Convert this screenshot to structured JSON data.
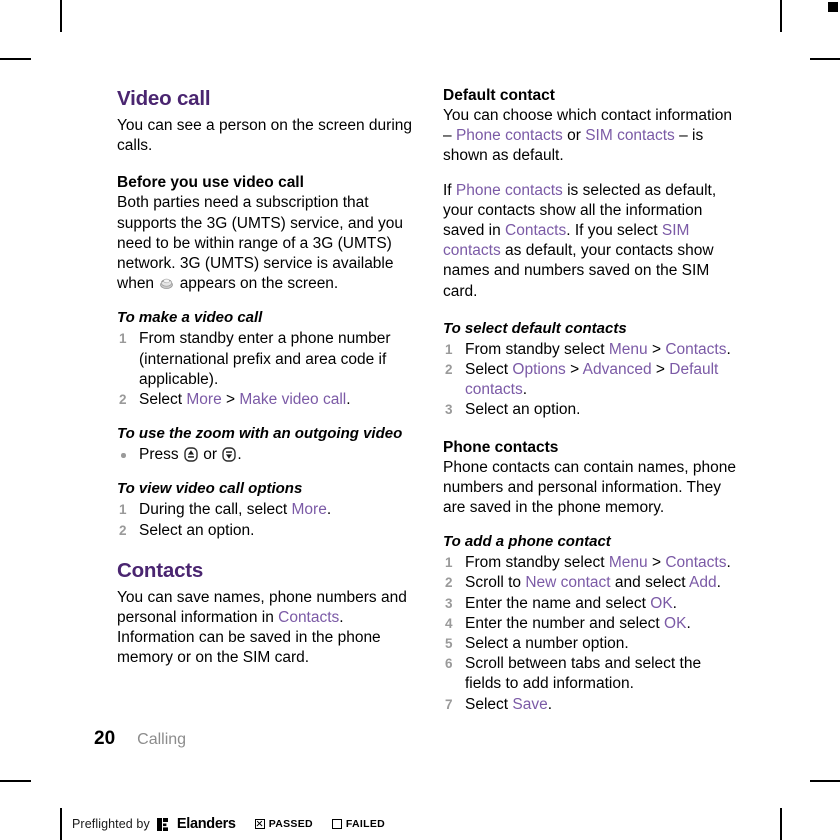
{
  "document": {
    "page_number": "20",
    "chapter_label": "Calling",
    "accent_heading_color": "#4a2570",
    "accent_ui_color": "#7b5aa6",
    "step_number_color": "#9a9a9a"
  },
  "left_column": {
    "chapter_title": "Video call",
    "intro": "You can see a person on the screen during calls.",
    "before_heading": "Before you use video call",
    "before_body_1": "Both parties need a subscription that supports the 3G (UMTS) service, and you need to be within range of a 3G (UMTS) network. 3G (UMTS) service is available when",
    "before_body_2": "appears on the screen.",
    "icon_3g_name": "3g-umts-icon",
    "make_call": {
      "heading": "To make a video call",
      "steps": [
        {
          "pre": "From standby enter a phone number (international prefix and area code if applicable).",
          "ui": "",
          "mid": "",
          "ui2": "",
          "post": ""
        },
        {
          "pre": "Select ",
          "ui": "More",
          "mid": " > ",
          "ui2": "Make video call",
          "post": "."
        }
      ]
    },
    "zoom_outgoing": {
      "heading": "To use the zoom with an outgoing video",
      "bullet_pre": "Press",
      "bullet_mid": "or",
      "bullet_post": ".",
      "icon_up_name": "volume-up-key-icon",
      "icon_down_name": "volume-down-key-icon"
    },
    "view_options": {
      "heading": "To view video call options",
      "steps": [
        {
          "pre": "During the call, select ",
          "ui": "More",
          "mid": "",
          "ui2": "",
          "post": "."
        },
        {
          "pre": "Select an option.",
          "ui": "",
          "mid": "",
          "ui2": "",
          "post": ""
        }
      ]
    },
    "contacts_title": "Contacts",
    "contacts_body_pre": "You can save names, phone numbers and personal information in ",
    "contacts_body_ui": "Contacts",
    "contacts_body_post": ". Information can be saved in the phone memory or on the SIM card."
  },
  "right_column": {
    "default_contact": {
      "heading": "Default contact",
      "p1_a": "You can choose which contact information – ",
      "p1_ui1": "Phone contacts",
      "p1_b": " or ",
      "p1_ui2": "SIM contacts",
      "p1_c": " – is shown as default.",
      "p2_a": "If ",
      "p2_ui1": "Phone contacts",
      "p2_b": " is selected as default, your contacts show all the information saved in ",
      "p2_ui2": "Contacts",
      "p2_c": ". If you select ",
      "p2_ui3": "SIM contacts",
      "p2_d": " as default, your contacts show names and numbers saved on the SIM card."
    },
    "select_default": {
      "heading": "To select default contacts",
      "steps": [
        {
          "pre": "From standby select ",
          "ui": "Menu",
          "mid": " > ",
          "ui2": "Contacts",
          "post": "."
        },
        {
          "pre": "Select ",
          "ui": "Options",
          "mid": " > ",
          "ui2": "Advanced",
          "mid2": " > ",
          "ui3": "Default contacts",
          "post": "."
        },
        {
          "pre": "Select an option.",
          "ui": "",
          "mid": "",
          "ui2": "",
          "post": ""
        }
      ]
    },
    "phone_contacts": {
      "heading": "Phone contacts",
      "body": "Phone contacts can contain names, phone numbers and personal information. They are saved in the phone memory."
    },
    "add_contact": {
      "heading": "To add a phone contact",
      "steps": [
        {
          "pre": "From standby select ",
          "ui": "Menu",
          "mid": " > ",
          "ui2": "Contacts",
          "post": "."
        },
        {
          "pre": "Scroll to ",
          "ui": "New contact",
          "mid": " and select ",
          "ui2": "Add",
          "post": "."
        },
        {
          "pre": "Enter the name and select ",
          "ui": "OK",
          "mid": "",
          "ui2": "",
          "post": "."
        },
        {
          "pre": "Enter the number and select ",
          "ui": "OK",
          "mid": "",
          "ui2": "",
          "post": "."
        },
        {
          "pre": "Select a number option.",
          "ui": "",
          "mid": "",
          "ui2": "",
          "post": ""
        },
        {
          "pre": "Scroll between tabs and select the fields to add information.",
          "ui": "",
          "mid": "",
          "ui2": "",
          "post": ""
        },
        {
          "pre": "Select ",
          "ui": "Save",
          "mid": "",
          "ui2": "",
          "post": "."
        }
      ]
    }
  },
  "preflight": {
    "text": "Preflighted by",
    "logo_name": "Elanders",
    "passed_label": "PASSED",
    "failed_label": "FAILED",
    "passed_checked": true,
    "failed_checked": false
  }
}
